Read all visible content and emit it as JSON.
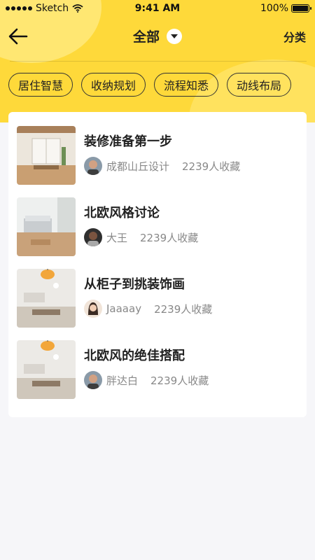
{
  "status_bar": {
    "carrier": "Sketch",
    "time": "9:41 AM",
    "battery": "100%"
  },
  "nav": {
    "title": "全部",
    "right_label": "分类"
  },
  "chips": [
    "居住智慧",
    "收纳规划",
    "流程知悉",
    "动线布局"
  ],
  "articles": [
    {
      "title": "装修准备第一步",
      "author": "成都山丘设计",
      "saves": "2239人收藏"
    },
    {
      "title": "北欧风格讨论",
      "author": "大王",
      "saves": "2239人收藏"
    },
    {
      "title": "从柜子到挑装饰画",
      "author": "Jaaaay",
      "saves": "2239人收藏"
    },
    {
      "title": "北欧风的绝佳搭配",
      "author": "胖达白",
      "saves": "2239人收藏"
    }
  ],
  "colors": {
    "header": "#fed93a",
    "background": "#f6f6f9",
    "text": "#222222",
    "meta": "#888888"
  },
  "icons": {
    "back": "arrow-left-icon",
    "dropdown": "caret-down-icon",
    "wifi": "wifi-icon"
  }
}
